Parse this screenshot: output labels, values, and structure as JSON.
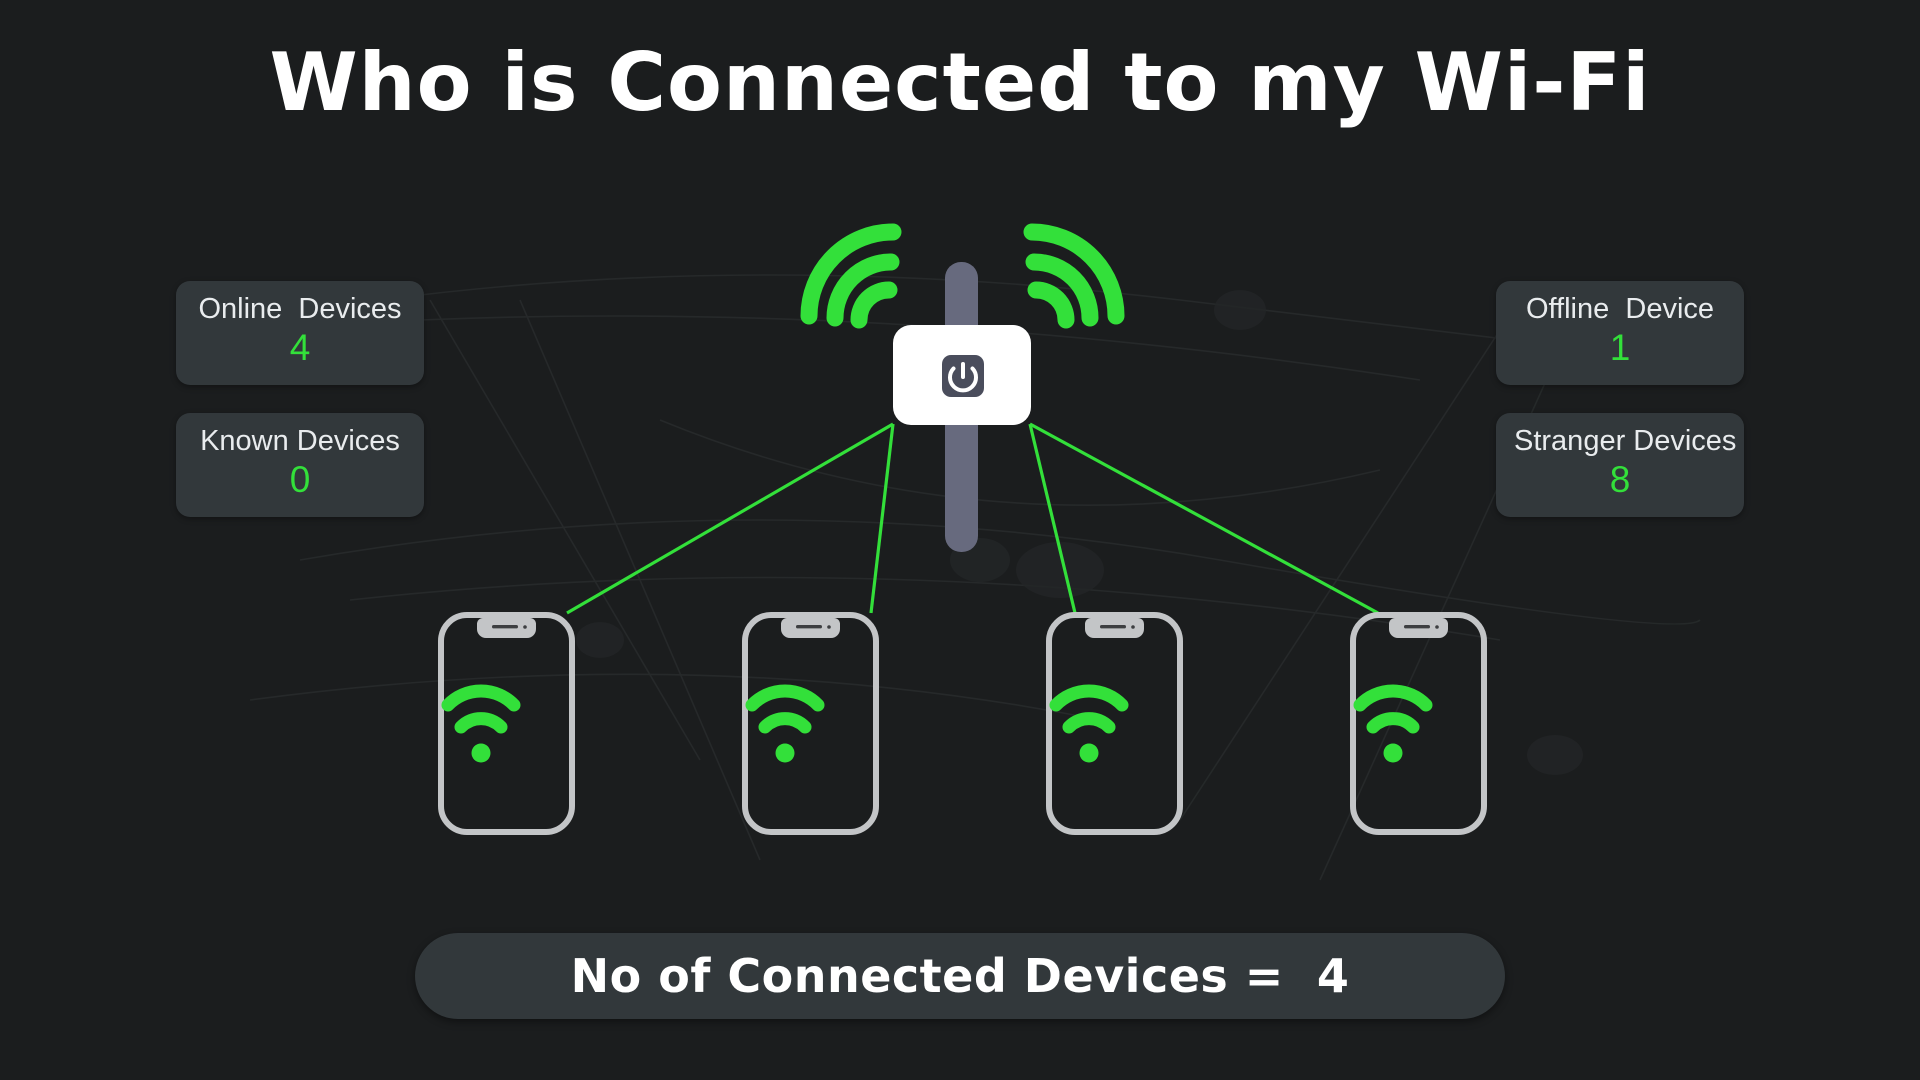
{
  "page": {
    "title": "Who is Connected to my Wi-Fi",
    "background_color": "#1b1d1e",
    "accent_green": "#33e03a",
    "card_color": "#32383b"
  },
  "stats": {
    "online": {
      "label": "Online  Devices",
      "value": "4"
    },
    "known": {
      "label": "Known Devices",
      "value": "0"
    },
    "offline": {
      "label": "Offline  Device",
      "value": "1"
    },
    "stranger": {
      "label": "Stranger Devices",
      "value": "8"
    }
  },
  "router": {
    "icon": "power-icon",
    "signal_left": "wifi-signal-icon",
    "signal_right": "wifi-signal-icon",
    "antenna": "antenna-bar"
  },
  "devices": [
    {
      "name": "phone-1",
      "status_icon": "wifi-icon"
    },
    {
      "name": "phone-2",
      "status_icon": "wifi-icon"
    },
    {
      "name": "phone-3",
      "status_icon": "wifi-icon"
    },
    {
      "name": "phone-4",
      "status_icon": "wifi-icon"
    }
  ],
  "summary": {
    "text": "No of Connected Devices =  4"
  }
}
